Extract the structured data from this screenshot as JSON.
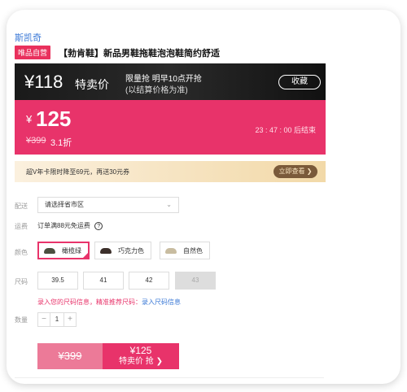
{
  "brand": "斯凯奇",
  "tag": "唯品自营",
  "title": "【勃肯鞋】新品男鞋拖鞋泡泡鞋简约舒适",
  "flash": {
    "price": "¥118",
    "label": "特卖价",
    "info_line1": "限量抢 明早10点开抢",
    "info_line2": "(以结算价格为准)",
    "button": "收藏"
  },
  "current": {
    "currency": "¥",
    "price": "125",
    "original": "¥399",
    "discount": "3.1折",
    "countdown": "23 : 47 : 00  后结束"
  },
  "vip": {
    "text": "超V年卡限时降至69元，再送30元券",
    "button": "立即查看 ❯"
  },
  "labels": {
    "ship": "配送",
    "freight": "运费",
    "color": "颜色",
    "size": "尺码",
    "qty": "数量"
  },
  "ship_select": "请选择省市区",
  "ship_chevron": "⌄",
  "freight_text": "订单满88元免运费",
  "freight_help": "?",
  "colors": [
    {
      "name": "橄榄绿",
      "swatch": "#4b4f3f",
      "selected": true
    },
    {
      "name": "巧克力色",
      "swatch": "#3b2f2a",
      "selected": false
    },
    {
      "name": "自然色",
      "swatch": "#c8bca0",
      "selected": false
    }
  ],
  "sizes": [
    {
      "label": "39.5",
      "disabled": false
    },
    {
      "label": "41",
      "disabled": false
    },
    {
      "label": "42",
      "disabled": false
    },
    {
      "label": "43",
      "disabled": true
    }
  ],
  "size_hint": "录入您的尺码信息，精准推荐尺码：",
  "size_link": "录入尺码信息",
  "quantity": {
    "minus": "−",
    "value": "1",
    "plus": "+"
  },
  "buy": {
    "original": "¥399",
    "price": "¥125",
    "label": "特卖价 抢 ❯"
  }
}
